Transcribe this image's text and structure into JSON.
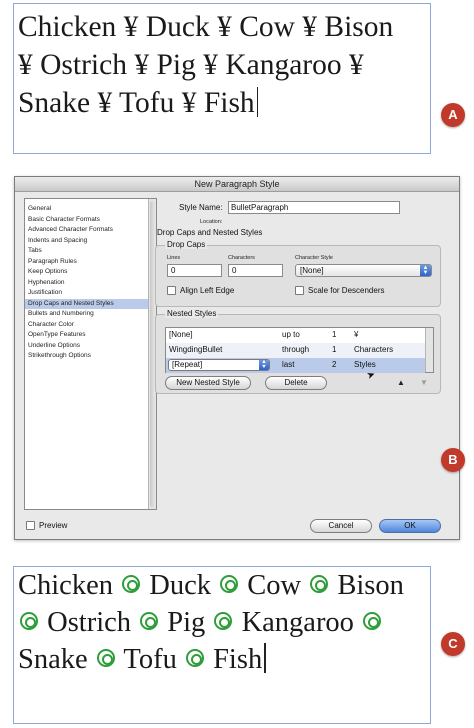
{
  "frame_a": {
    "lines": [
      "Chicken ¥ Duck ¥ Cow ¥ Bison",
      "¥ Ostrich ¥ Pig ¥ Kangaroo ¥",
      "Snake ¥ Tofu ¥ Fish"
    ]
  },
  "markers": {
    "a": "A",
    "b": "B",
    "c": "C"
  },
  "dialog": {
    "title": "New Paragraph Style",
    "categories": [
      "General",
      "Basic Character Formats",
      "Advanced Character Formats",
      "Indents and Spacing",
      "Tabs",
      "Paragraph Rules",
      "Keep Options",
      "Hyphenation",
      "Justification",
      "Drop Caps and Nested Styles",
      "Bullets and Numbering",
      "Character Color",
      "OpenType Features",
      "Underline Options",
      "Strikethrough Options"
    ],
    "selected_category": "Drop Caps and Nested Styles",
    "style_name_label": "Style Name:",
    "style_name_value": "BulletParagraph",
    "location_label": "Location:",
    "section_title": "Drop Caps and Nested Styles",
    "drop_caps": {
      "group_label": "Drop Caps",
      "lines_label": "Lines",
      "lines_value": "0",
      "characters_label": "Characters",
      "characters_value": "0",
      "char_style_label": "Character Style",
      "char_style_value": "[None]",
      "align_left_edge_label": "Align Left Edge",
      "scale_for_descenders_label": "Scale for Descenders"
    },
    "nested_styles": {
      "group_label": "Nested Styles",
      "rows": [
        {
          "style": "[None]",
          "mode": "up to",
          "count": "1",
          "until": "¥"
        },
        {
          "style": "WingdingBullet",
          "mode": "through",
          "count": "1",
          "until": "Characters"
        },
        {
          "style": "[Repeat]",
          "mode": "last",
          "count": "2",
          "until": "Styles"
        }
      ],
      "new_button": "New Nested Style",
      "delete_button": "Delete",
      "up_arrow": "▲",
      "down_arrow": "▼"
    },
    "preview_label": "Preview",
    "cancel_button": "Cancel",
    "ok_button": "OK"
  },
  "frame_c": {
    "lines": [
      [
        "Chicken",
        "Duck",
        "Cow",
        "Bison"
      ],
      [
        "",
        "Ostrich",
        "Pig",
        "Kangaroo",
        ""
      ],
      [
        "Snake",
        "Tofu",
        "Fish"
      ]
    ]
  },
  "colors": {
    "marker": "#c0392b",
    "bullet_green": "#2f9e3a",
    "selection": "#b9cbe8"
  }
}
